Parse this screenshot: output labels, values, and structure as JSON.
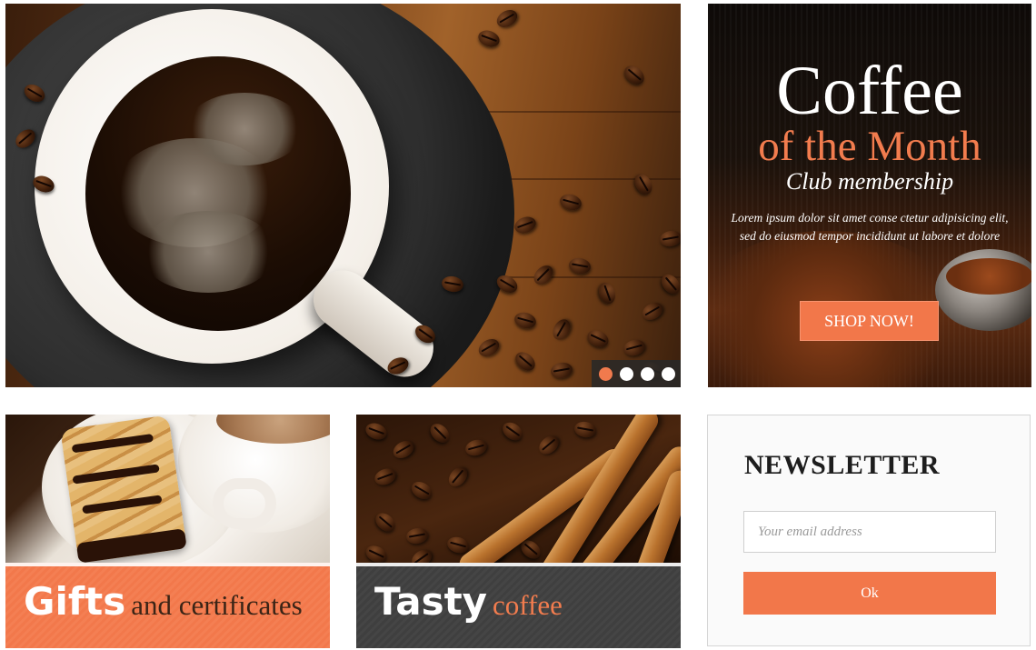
{
  "hero": {
    "slides": [
      {
        "state": "active",
        "color": "#f07a4d"
      },
      {
        "state": "inactive",
        "color": "#ffffff"
      },
      {
        "state": "inactive",
        "color": "#ffffff"
      },
      {
        "state": "inactive",
        "color": "#ffffff"
      }
    ]
  },
  "promo": {
    "title": "Coffee",
    "subtitle": "of the Month",
    "tagline": "Club membership",
    "body": "Lorem ipsum dolor sit amet conse ctetur adipisicing elit, sed do eiusmod tempor incididunt ut labore et dolore",
    "button_label": "SHOP NOW!",
    "accent_color": "#f2774a"
  },
  "gifts": {
    "title_big": "Gifts",
    "title_small": "and certificates",
    "band_color": "#f2784b"
  },
  "tasty": {
    "title_big": "Tasty",
    "title_small": "coffee",
    "band_color": "#404040",
    "accent_color": "#f27c4e"
  },
  "newsletter": {
    "title": "NEWSLETTER",
    "placeholder": "Your email address",
    "value": "",
    "button_label": "Ok"
  },
  "icons": [
    "coffee-cup-photo",
    "coffee-beans-photo",
    "slider-dot",
    "biscotti-photo",
    "cinnamon-photo"
  ]
}
